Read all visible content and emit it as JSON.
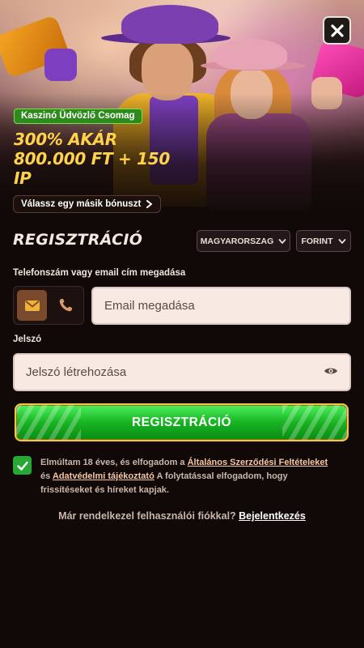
{
  "hero": {
    "badge": "Kaszinó Üdvözlő Csomag",
    "promo_line1": "300% AKÁR",
    "promo_line2": "800.000 FT + 150",
    "promo_line3": "IP",
    "other_bonus_label": "Válassz egy másik bónuszt"
  },
  "registration": {
    "title": "REGISZTRÁCIÓ",
    "country": "MAGYARORSZAG",
    "currency": "FORINT",
    "contact_label": "Telefonszám vagy email cím megadása",
    "email_placeholder": "Email megadása",
    "password_label": "Jelszó",
    "password_placeholder": "Jelszó létrehozása",
    "submit_label": "REGISZTRÁCIÓ"
  },
  "terms": {
    "text_1": "Elmúltam 18 éves, és elfogadom a ",
    "link_1": "Általános Szerződési Feltételeket",
    "text_2": " és ",
    "link_2": "Adatvédelmi tájékoztató",
    "text_3": " A folytatással elfogadom, hogy frissítéseket és híreket kapjak.",
    "checked": true
  },
  "login": {
    "prompt": "Már rendelkezel felhasználói fiókkal? ",
    "link": "Bejelentkezés"
  },
  "colors": {
    "accent_gold": "#ffd24a",
    "button_green": "#18b423",
    "badge_green": "#2f8a1e",
    "background": "#100907"
  },
  "icons": {
    "close": "close-icon",
    "email": "envelope-icon",
    "phone": "phone-icon",
    "password_visibility": "eye-icon",
    "checkbox": "checkmark-icon",
    "dropdown": "chevron-down-icon",
    "other_bonus": "chevron-right-icon"
  }
}
